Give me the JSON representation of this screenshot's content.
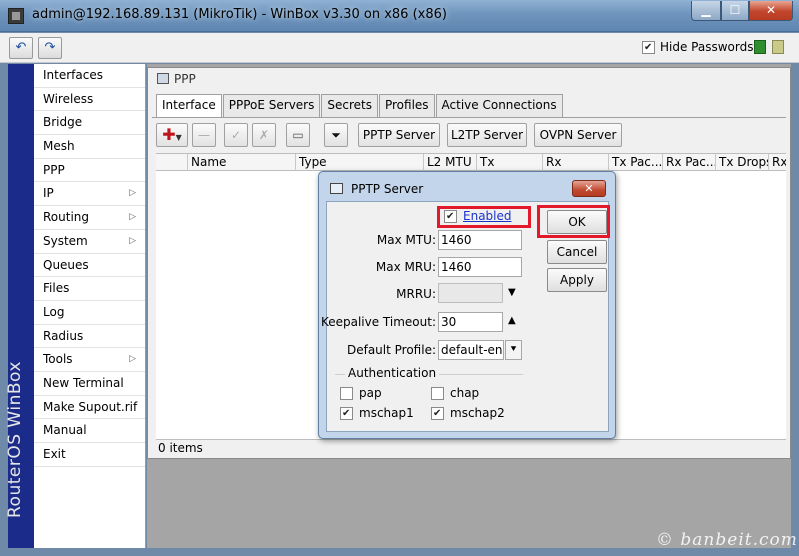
{
  "window": {
    "title": "admin@192.168.89.131 (MikroTik) - WinBox v3.30 on x86 (x86)",
    "min": "▁",
    "max": "☐",
    "close": "✕"
  },
  "toolbar": {
    "undo": "↶",
    "redo": "↷",
    "hide_passwords_label": "Hide Passwords",
    "hide_passwords_checked": true
  },
  "brand": "RouterOS WinBox",
  "sidebar": {
    "items": [
      {
        "label": "Interfaces"
      },
      {
        "label": "Wireless"
      },
      {
        "label": "Bridge"
      },
      {
        "label": "Mesh"
      },
      {
        "label": "PPP"
      },
      {
        "label": "IP",
        "submenu": true
      },
      {
        "label": "Routing",
        "submenu": true
      },
      {
        "label": "System",
        "submenu": true
      },
      {
        "label": "Queues"
      },
      {
        "label": "Files"
      },
      {
        "label": "Log"
      },
      {
        "label": "Radius"
      },
      {
        "label": "Tools",
        "submenu": true
      },
      {
        "label": "New Terminal"
      },
      {
        "label": "Make Supout.rif"
      },
      {
        "label": "Manual"
      },
      {
        "label": "Exit"
      }
    ]
  },
  "ppp": {
    "title": "PPP",
    "tabs": [
      "Interface",
      "PPPoE Servers",
      "Secrets",
      "Profiles",
      "Active Connections"
    ],
    "active_tab": "Interface",
    "buttons": {
      "pptp": "PPTP Server",
      "l2tp": "L2TP Server",
      "ovpn": "OVPN Server"
    },
    "columns": [
      "Name",
      "Type",
      "L2 MTU",
      "Tx",
      "Rx",
      "Tx Pac...",
      "Rx Pac...",
      "Tx Drops",
      "Rx"
    ],
    "status": "0 items"
  },
  "dialog": {
    "title": "PPTP Server",
    "enabled_label": "Enabled",
    "enabled": true,
    "max_mtu_label": "Max MTU:",
    "max_mtu": "1460",
    "max_mru_label": "Max MRU:",
    "max_mru": "1460",
    "mrru_label": "MRRU:",
    "mrru": "",
    "keepalive_label": "Keepalive Timeout:",
    "keepalive": "30",
    "profile_label": "Default Profile:",
    "profile": "default-encr",
    "auth_label": "Authentication",
    "auth": [
      {
        "name": "pap",
        "checked": false
      },
      {
        "name": "chap",
        "checked": false
      },
      {
        "name": "mschap1",
        "checked": true
      },
      {
        "name": "mschap2",
        "checked": true
      }
    ],
    "ok": "OK",
    "cancel": "Cancel",
    "apply": "Apply",
    "close": "✕"
  },
  "watermark": "© banbeit.com",
  "colors": {
    "brand_bg": "#1b2b89",
    "highlight": "#e3192b",
    "link": "#1a33cc"
  }
}
